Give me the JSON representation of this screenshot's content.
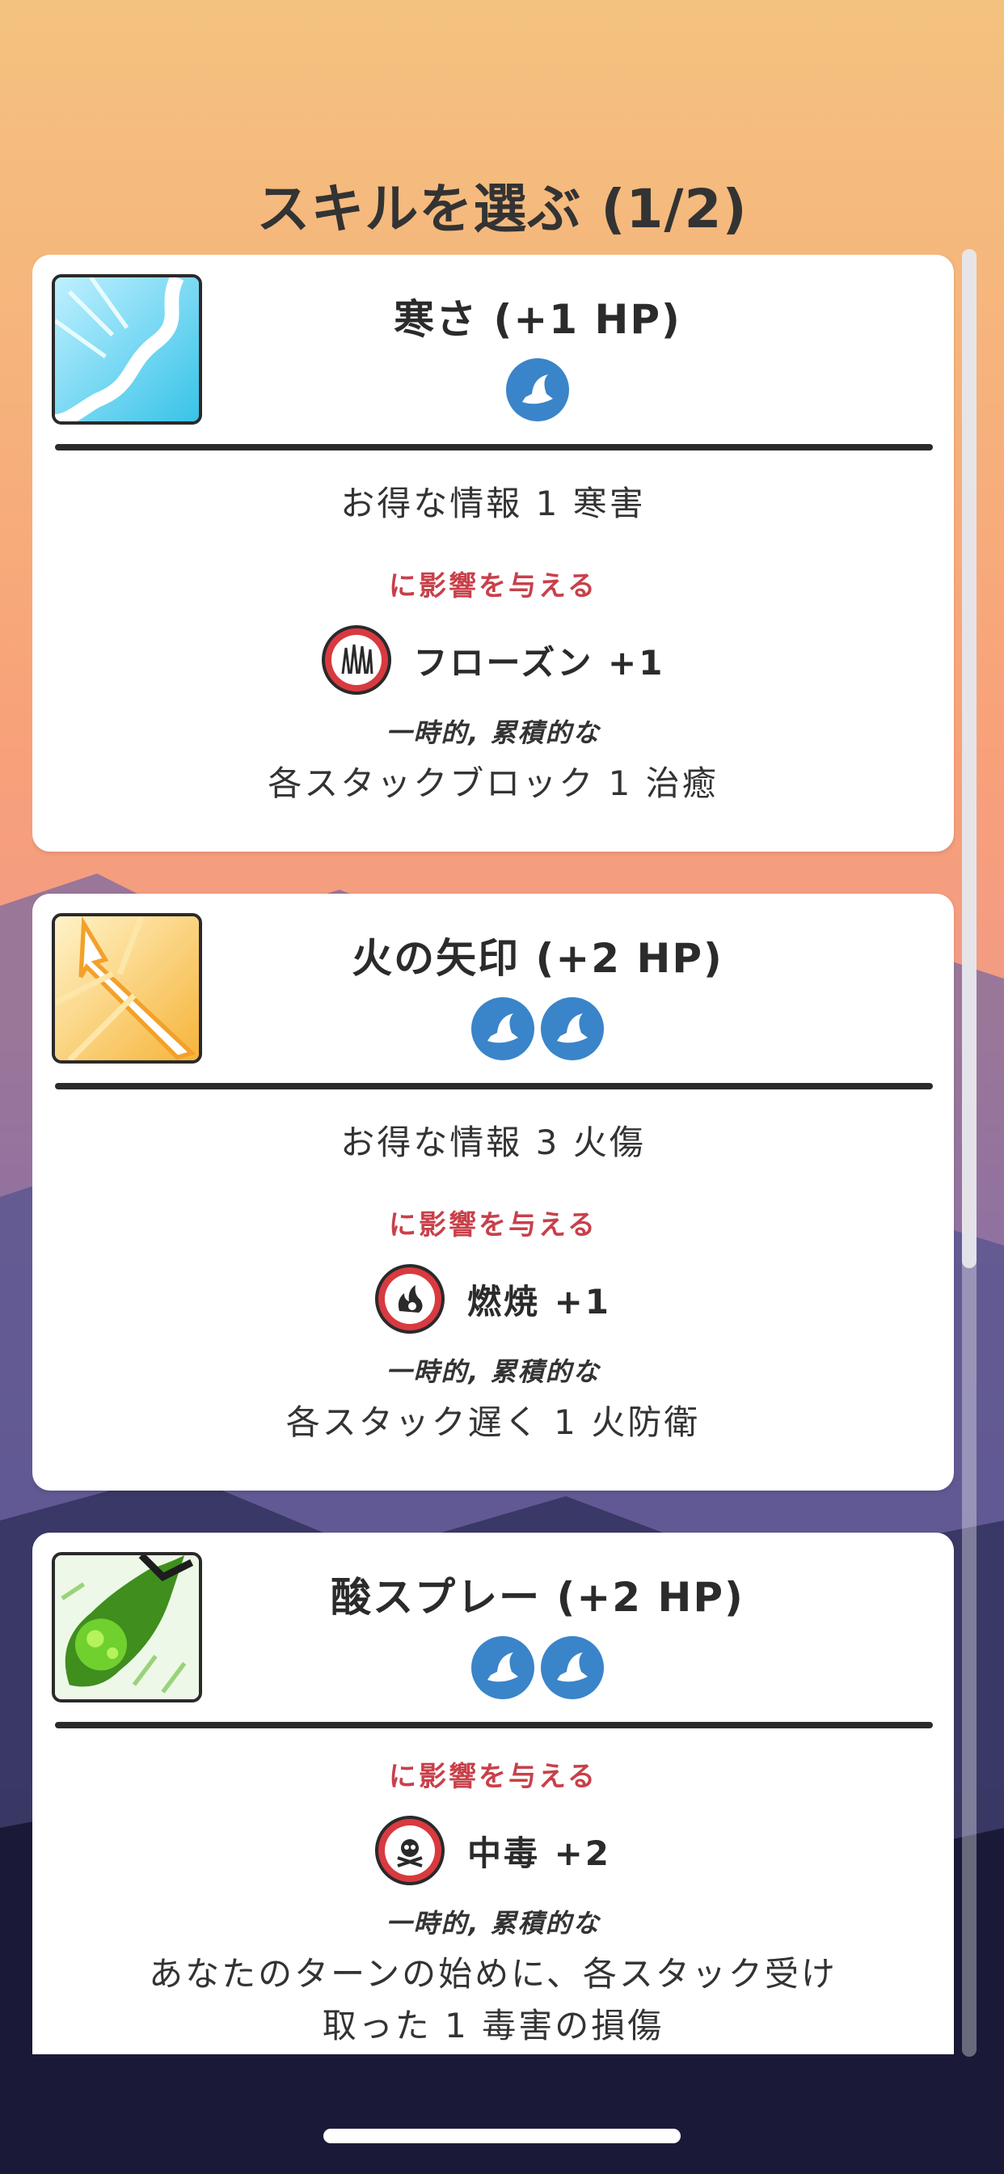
{
  "page_title": "スキルを選ぶ (1/2)",
  "colors": {
    "cost_badge": "#3a84c9",
    "affect_label": "#c8404a",
    "status_ring": "#d83a40"
  },
  "skills": [
    {
      "name": "寒さ (+1 HP)",
      "image_icon": "frost-skill-image",
      "cost_icons": [
        "wizard-hat-icon"
      ],
      "info": "お得な情報 1 寒害",
      "affect_label": "に影響を与える",
      "status_icon": "frozen-status-icon",
      "status_text": "フローズン +1",
      "temp_label": "一時的, 累積的な",
      "description": [
        "各スタックブロック 1 治癒"
      ]
    },
    {
      "name": "火の矢印 (+2 HP)",
      "image_icon": "fire-arrow-skill-image",
      "cost_icons": [
        "wizard-hat-icon",
        "wizard-hat-icon"
      ],
      "info": "お得な情報 3 火傷",
      "affect_label": "に影響を与える",
      "status_icon": "burn-status-icon",
      "status_text": "燃焼 +1",
      "temp_label": "一時的, 累積的な",
      "description": [
        "各スタック遅く 1 火防衛"
      ]
    },
    {
      "name": "酸スプレー (+2 HP)",
      "image_icon": "acid-spray-skill-image",
      "cost_icons": [
        "wizard-hat-icon",
        "wizard-hat-icon"
      ],
      "affect_label": "に影響を与える",
      "status_icon": "poison-status-icon",
      "status_text": "中毒 +2",
      "temp_label": "一時的, 累積的な",
      "description": [
        "あなたのターンの始めに、各スタック受け",
        "取った 1 毒害の損傷"
      ]
    }
  ]
}
